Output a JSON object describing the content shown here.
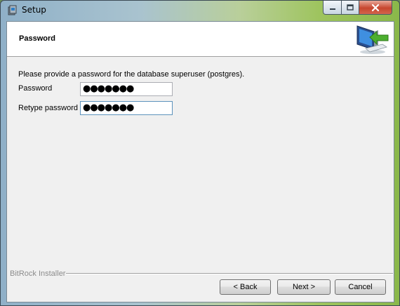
{
  "window": {
    "title": "Setup",
    "controls": {
      "minimize_icon": "minimize-icon",
      "maximize_icon": "maximize-icon",
      "close_icon": "close-icon"
    }
  },
  "header": {
    "title": "Password",
    "icon": "computer-arrow-icon"
  },
  "form": {
    "description": "Please provide a password for the database superuser (postgres).",
    "password_label": "Password",
    "password_value": "●●●●●●●",
    "retype_label": "Retype password",
    "retype_value": "●●●●●●●"
  },
  "footer": {
    "brand": "BitRock Installer",
    "back_label": "< Back",
    "next_label": "Next >",
    "cancel_label": "Cancel"
  },
  "colors": {
    "close_button": "#c7462f",
    "header_background": "#ffffff",
    "dialog_background": "#f0f0f0"
  }
}
